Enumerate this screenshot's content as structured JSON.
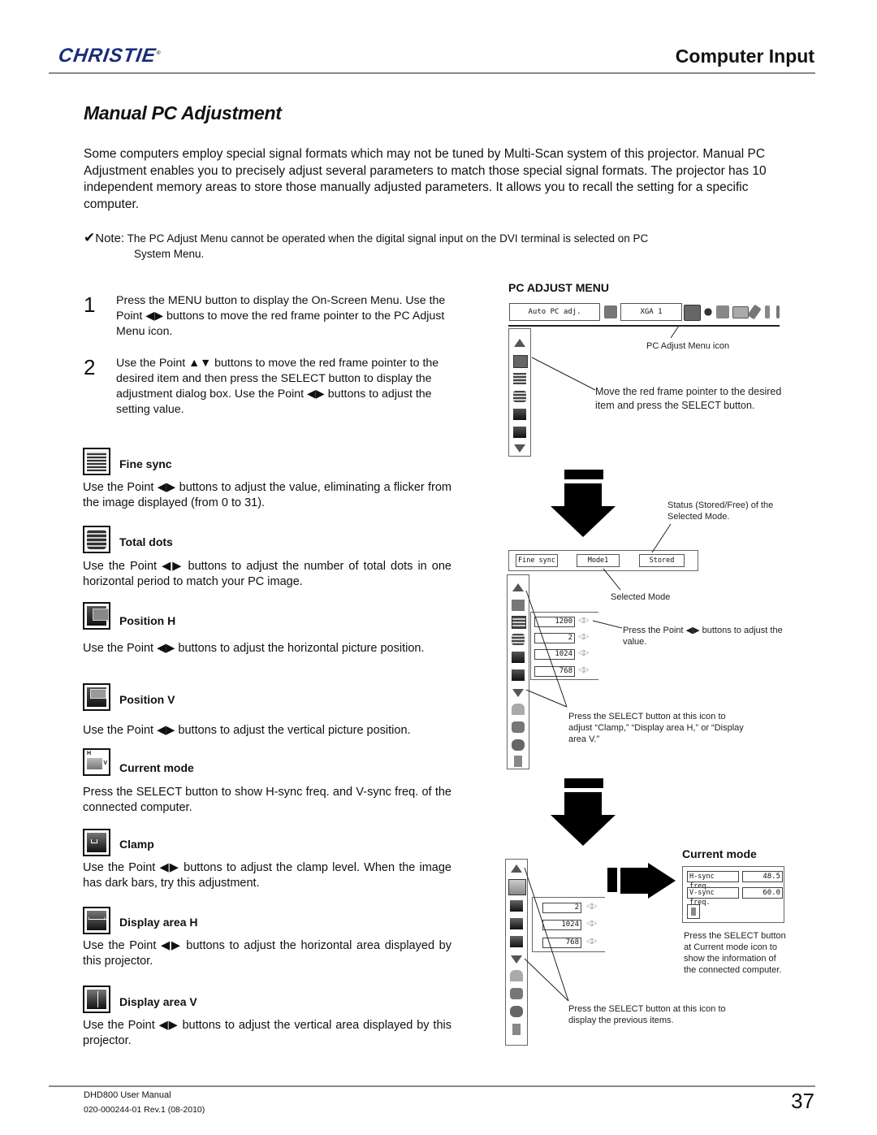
{
  "header": {
    "brand": "CHRISTIE",
    "section_title": "Computer Input"
  },
  "page_title": "Manual PC Adjustment",
  "intro": "Some computers employ special signal formats which may not be tuned by Multi-Scan system of this projector. Manual PC Adjustment enables you to precisely adjust several parameters to match those special signal formats. The projector has 10 independent memory areas to store those manually adjusted parameters. It allows you to recall the setting for a specific computer.",
  "note": {
    "label": "Note:",
    "line1": "The PC Adjust Menu cannot be operated when the digital signal input on the DVI terminal is selected on PC",
    "line2": "System Menu."
  },
  "steps": [
    {
      "num": "1",
      "text": "Press the MENU button to display the On-Screen Menu. Use the Point ◀▶ buttons to move the red frame pointer to the PC Adjust Menu icon."
    },
    {
      "num": "2",
      "text": "Use the Point ▲▼ buttons to move the red frame pointer to the desired item and then press the SELECT button to display the adjustment dialog box. Use the Point ◀▶ buttons to adjust the setting value."
    }
  ],
  "features": [
    {
      "icon": "fine-sync-icon",
      "title": "Fine sync",
      "desc": "Use the Point ◀▶ buttons to adjust the value, eliminating a flicker from the image displayed (from 0 to 31)."
    },
    {
      "icon": "total-dots-icon",
      "title": "Total dots",
      "desc": "Use the Point ◀▶ buttons to adjust the number of total dots in one horizontal period to match your PC image."
    },
    {
      "icon": "position-h-icon",
      "title": "Position H",
      "desc": "Use the Point ◀▶ buttons to adjust the horizontal picture position."
    },
    {
      "icon": "position-v-icon",
      "title": "Position V",
      "desc": "Use the Point ◀▶ buttons to adjust the vertical picture position."
    },
    {
      "icon": "current-mode-icon",
      "title": "Current mode",
      "desc": "Press the SELECT button to show H-sync freq. and V-sync freq. of the connected computer."
    },
    {
      "icon": "clamp-icon",
      "title": "Clamp",
      "desc": "Use the Point ◀▶ buttons to adjust the clamp level. When the image has dark bars, try this adjustment."
    },
    {
      "icon": "display-area-h-icon",
      "title": "Display area H",
      "desc": "Use the Point ◀▶ buttons to adjust the horizontal area displayed by this projector."
    },
    {
      "icon": "display-area-v-icon",
      "title": "Display area V",
      "desc": "Use the Point ◀▶ buttons to adjust the vertical area displayed by this projector."
    }
  ],
  "diagram": {
    "heading": "PC ADJUST MENU",
    "menubar": {
      "auto_pc": "Auto PC adj.",
      "mode": "XGA 1"
    },
    "captions": {
      "menu_icon": "PC Adjust Menu icon",
      "move_pointer": "Move the red frame pointer to the desired item and press the SELECT button.",
      "status": "Status (Stored/Free) of the Selected Mode.",
      "selected_mode": "Selected Mode",
      "point_adjust": "Press the Point ◀▶ buttons to adjust the value.",
      "select_more": "Press the SELECT button at this icon to adjust “Clamp,” “Display area H,” or “Display area V.”",
      "current_mode_info": "Press the SELECT button at Current mode icon to show the information of the connected computer.",
      "select_prev": "Press the SELECT button at this icon to display the previous items."
    },
    "panel2": {
      "item": "Fine sync",
      "mode": "Mode1",
      "status": "Stored",
      "values": [
        "1200",
        "2",
        "1024",
        "768"
      ]
    },
    "panel3": {
      "values": [
        "2",
        "1024",
        "768"
      ]
    },
    "current_mode": {
      "heading": "Current mode",
      "hsync_label": "H-sync freq.",
      "hsync_value": "48.5",
      "vsync_label": "V-sync freq.",
      "vsync_value": "60.0"
    }
  },
  "footer": {
    "manual": "DHD800 User Manual",
    "docnum": "020-000244-01 Rev.1 (08-2010)",
    "page": "37"
  }
}
